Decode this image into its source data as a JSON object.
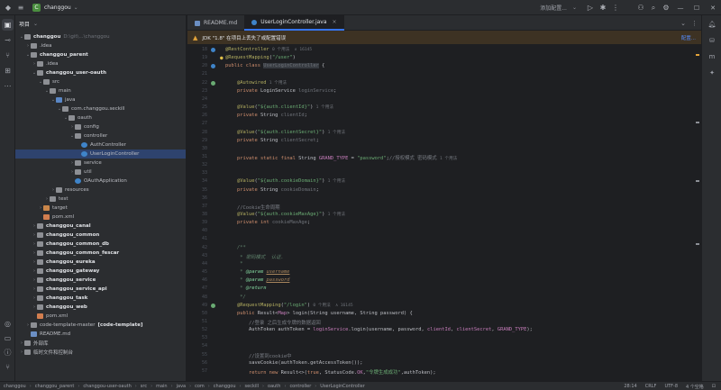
{
  "titlebar": {
    "project_badge": "C",
    "project_name": "changgou",
    "search_text": "添加配置...",
    "colors": {
      "badge": "#4a8e3f"
    }
  },
  "project_panel": {
    "header": "项目",
    "tree": [
      {
        "depth": 0,
        "arrow": "v",
        "icon": "folder",
        "label": "changgou",
        "muted": "D:\\git\\...\\changgou",
        "bold": true
      },
      {
        "depth": 1,
        "arrow": ">",
        "icon": "folder",
        "label": ".idea"
      },
      {
        "depth": 1,
        "arrow": "v",
        "icon": "folder",
        "label": "changgou_parent",
        "bold": true
      },
      {
        "depth": 2,
        "arrow": ">",
        "icon": "folder",
        "label": ".idea"
      },
      {
        "depth": 2,
        "arrow": "v",
        "icon": "folder",
        "label": "changgou_user-oauth",
        "bold": true
      },
      {
        "depth": 3,
        "arrow": "v",
        "icon": "folder",
        "label": "src"
      },
      {
        "depth": 4,
        "arrow": "v",
        "icon": "folder",
        "label": "main"
      },
      {
        "depth": 5,
        "arrow": "v",
        "icon": "folder-src",
        "label": "java"
      },
      {
        "depth": 6,
        "arrow": "v",
        "icon": "folder",
        "label": "com.changgou.seckill"
      },
      {
        "depth": 7,
        "arrow": "v",
        "icon": "folder",
        "label": "oauth"
      },
      {
        "depth": 8,
        "arrow": ">",
        "icon": "folder",
        "label": "config"
      },
      {
        "depth": 8,
        "arrow": "v",
        "icon": "folder",
        "label": "controller"
      },
      {
        "depth": 9,
        "arrow": "",
        "icon": "class",
        "label": "AuthController"
      },
      {
        "depth": 9,
        "arrow": "",
        "icon": "class",
        "label": "UserLoginController",
        "selected": true
      },
      {
        "depth": 8,
        "arrow": ">",
        "icon": "folder",
        "label": "service"
      },
      {
        "depth": 8,
        "arrow": ">",
        "icon": "folder",
        "label": "util"
      },
      {
        "depth": 8,
        "arrow": "",
        "icon": "class",
        "label": "OAuthApplication"
      },
      {
        "depth": 5,
        "arrow": ">",
        "icon": "folder",
        "label": "resources"
      },
      {
        "depth": 4,
        "arrow": ">",
        "icon": "folder",
        "label": "test"
      },
      {
        "depth": 3,
        "arrow": ">",
        "icon": "folder-orange",
        "label": "target"
      },
      {
        "depth": 3,
        "arrow": "",
        "icon": "xml",
        "label": "pom.xml"
      },
      {
        "depth": 2,
        "arrow": ">",
        "icon": "folder",
        "label": "changgou_canal",
        "bold": true
      },
      {
        "depth": 2,
        "arrow": ">",
        "icon": "folder",
        "label": "changgou_common",
        "bold": true
      },
      {
        "depth": 2,
        "arrow": ">",
        "icon": "folder",
        "label": "changgou_common_db",
        "bold": true
      },
      {
        "depth": 2,
        "arrow": ">",
        "icon": "folder",
        "label": "changgou_common_fescar",
        "bold": true
      },
      {
        "depth": 2,
        "arrow": ">",
        "icon": "folder",
        "label": "changgou_eureka",
        "bold": true
      },
      {
        "depth": 2,
        "arrow": ">",
        "icon": "folder",
        "label": "changgou_gateway",
        "bold": true
      },
      {
        "depth": 2,
        "arrow": ">",
        "icon": "folder",
        "label": "changgou_service",
        "bold": true
      },
      {
        "depth": 2,
        "arrow": ">",
        "icon": "folder",
        "label": "changgou_service_api",
        "bold": true
      },
      {
        "depth": 2,
        "arrow": ">",
        "icon": "folder",
        "label": "changgou_task",
        "bold": true
      },
      {
        "depth": 2,
        "arrow": ">",
        "icon": "folder",
        "label": "changgou_web",
        "bold": true
      },
      {
        "depth": 2,
        "arrow": "",
        "icon": "xml",
        "label": "pom.xml"
      },
      {
        "depth": 1,
        "arrow": ">",
        "icon": "folder",
        "label": "code-template-master",
        "extra": "[code-template]"
      },
      {
        "depth": 1,
        "arrow": "",
        "icon": "md",
        "label": "README.md"
      },
      {
        "depth": 0,
        "arrow": ">",
        "icon": "folder",
        "label": "外部库"
      },
      {
        "depth": 0,
        "arrow": ">",
        "icon": "folder",
        "label": "临时文件和控制台"
      }
    ]
  },
  "tabs": [
    {
      "label": "README.md",
      "icon": "md",
      "active": false
    },
    {
      "label": "UserLoginController.java",
      "icon": "class",
      "active": true
    }
  ],
  "banner": {
    "text": "JDK \"1.8\" 在项目上丢失了或配置错误",
    "link": "配置..."
  },
  "code_lines": [
    {
      "num": "18",
      "html": "<span class=\"an\">@RestController</span> <span class=\"hint\">0 个用法  ∧ 16145</span>"
    },
    {
      "num": "19",
      "html": "<span class=\"an\">@RequestMapping</span>(<span class=\"str\">\"/user\"</span>)"
    },
    {
      "num": "20",
      "html": "<span class=\"kw\">public class</span> <span class=\"cname\">UserLoginController</span> {"
    },
    {
      "num": "21",
      "html": ""
    },
    {
      "num": "22",
      "html": "    <span class=\"an\">@Autowired</span> <span class=\"hint\">1 个用法</span>"
    },
    {
      "num": "23",
      "html": "    <span class=\"kw\">private</span> LoginService <span class=\"unused\">loginService</span>;"
    },
    {
      "num": "24",
      "html": ""
    },
    {
      "num": "25",
      "html": "    <span class=\"an\">@Value</span>(<span class=\"str\">\"${auth.clientId}\"</span>) <span class=\"hint\">1 个用法</span>"
    },
    {
      "num": "26",
      "html": "    <span class=\"kw\">private</span> String <span class=\"unused\">clientId</span>;"
    },
    {
      "num": "27",
      "html": ""
    },
    {
      "num": "28",
      "html": "    <span class=\"an\">@Value</span>(<span class=\"str\">\"${auth.clientSecret}\"</span>) <span class=\"hint\">1 个用法</span>"
    },
    {
      "num": "29",
      "html": "    <span class=\"kw\">private</span> String <span class=\"unused\">clientSecret</span>;"
    },
    {
      "num": "30",
      "html": ""
    },
    {
      "num": "31",
      "html": "    <span class=\"kw\">private static final</span> String <span class=\"fld\">GRAND_TYPE</span> = <span class=\"str\">\"password\"</span>;<span class=\"cm\">//授权模式 密码模式</span> <span class=\"hint\">1 个用法</span>"
    },
    {
      "num": "32",
      "html": ""
    },
    {
      "num": "33",
      "html": ""
    },
    {
      "num": "34",
      "html": "    <span class=\"an\">@Value</span>(<span class=\"str\">\"${auth.cookieDomain}\"</span>) <span class=\"hint\">1 个用法</span>"
    },
    {
      "num": "35",
      "html": "    <span class=\"kw\">private</span> String <span class=\"unused\">cookieDomain</span>;"
    },
    {
      "num": "36",
      "html": ""
    },
    {
      "num": "37",
      "html": "    <span class=\"cm\">//Cookie生命周期</span>"
    },
    {
      "num": "38",
      "html": "    <span class=\"an\">@Value</span>(<span class=\"str\">\"${auth.cookieMaxAge}\"</span>) <span class=\"hint\">1 个用法</span>"
    },
    {
      "num": "39",
      "html": "    <span class=\"kw\">private int</span> <span class=\"unused\">cookieMaxAge</span>;"
    },
    {
      "num": "40",
      "html": ""
    },
    {
      "num": "41",
      "html": ""
    },
    {
      "num": "42",
      "html": "    <span class=\"jd\">/**</span>"
    },
    {
      "num": "43",
      "html": "     <span class=\"jd\">* 密码模式  认证.</span>"
    },
    {
      "num": "44",
      "html": "     <span class=\"jd\">*</span>"
    },
    {
      "num": "45",
      "html": "     <span class=\"jd\">*</span> <span class=\"jtag\">@param</span> <span class=\"jpar\">username</span>"
    },
    {
      "num": "46",
      "html": "     <span class=\"jd\">*</span> <span class=\"jtag\">@param</span> <span class=\"jpar\">password</span>"
    },
    {
      "num": "47",
      "html": "     <span class=\"jd\">*</span> <span class=\"jtag\">@return</span>"
    },
    {
      "num": "48",
      "html": "     <span class=\"jd\">*/</span>"
    },
    {
      "num": "49",
      "html": "    <span class=\"an\">@RequestMapping</span>(<span class=\"str\">\"/login\"</span>) <span class=\"hint\">0 个用法  ∧ 16145</span>"
    },
    {
      "num": "50",
      "html": "    <span class=\"kw\">public</span> Result&lt;<span class=\"fld\">Map</span>&gt; login(String username, String password) {"
    },
    {
      "num": "51",
      "html": "        <span class=\"cm\">//登录 之后生成令牌的数据返回</span>"
    },
    {
      "num": "52",
      "html": "        AuthToken authToken = <span class=\"fld\">loginService</span>.login(username, password, <span class=\"fld\">clientId</span>, <span class=\"fld\">clientSecret</span>, <span class=\"fld\">GRAND_TYPE</span>);"
    },
    {
      "num": "53",
      "html": ""
    },
    {
      "num": "54",
      "html": ""
    },
    {
      "num": "55",
      "html": "        <span class=\"cm\">//设置到cookie中</span>"
    },
    {
      "num": "56",
      "html": "        saveCookie(authToken.getAccessToken());"
    },
    {
      "num": "57",
      "html": "        <span class=\"kw\">return new</span> Result&lt;&gt;(<span class=\"kw\">true</span>, StatusCode.<span class=\"fld\">OK</span>,<span class=\"str\">\"令牌生成成功\"</span>,authToken);"
    }
  ],
  "status": {
    "breadcrumbs": [
      "changgou",
      "changgou_parent",
      "changgou-user-oauth",
      "src",
      "main",
      "java",
      "com",
      "changgou",
      "seckill",
      "oauth",
      "controller",
      "UserLoginController"
    ],
    "position": "28:14",
    "line_sep": "CRLF",
    "encoding": "UTF-8",
    "indent": "4 个空格"
  }
}
